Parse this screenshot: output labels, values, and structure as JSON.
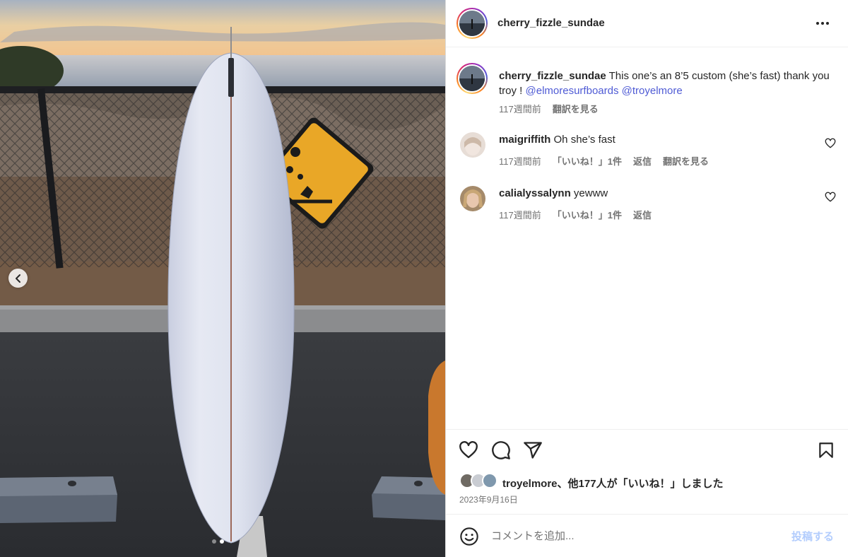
{
  "post": {
    "username": "cherry_fizzle_sundae",
    "header_more_icon": "more-horizontal-icon"
  },
  "media": {
    "prev_icon": "chevron-left-icon",
    "dots_total": 2,
    "dots_active_index": 1
  },
  "caption": {
    "username": "cherry_fizzle_sundae",
    "text": " This one’s an 8’5 custom (she’s fast) thank you troy ! ",
    "mention_1": "@elmoresurfboards",
    "mention_2": "@troyelmore",
    "time": "117週間前",
    "translate": "翻訳を見る"
  },
  "comments": [
    {
      "username": "maigriffith",
      "text": " Oh she’s fast",
      "time": "117週間前",
      "likes": "「いいね！」1件",
      "reply": "返信",
      "translate": "翻訳を見る"
    },
    {
      "username": "calialyssalynn",
      "text": " yewww",
      "time": "117週間前",
      "likes": "「いいね！」1件",
      "reply": "返信"
    }
  ],
  "actions": {
    "likes_text": "troyelmore、他177人が「いいね！」しました",
    "date": "2023年9月16日"
  },
  "composer": {
    "placeholder": "コメントを追加...",
    "post_label": "投稿する"
  },
  "colors": {
    "link": "#4f5bd5",
    "post_button_disabled": "#b3cdfd",
    "secondary_text": "#737373"
  }
}
